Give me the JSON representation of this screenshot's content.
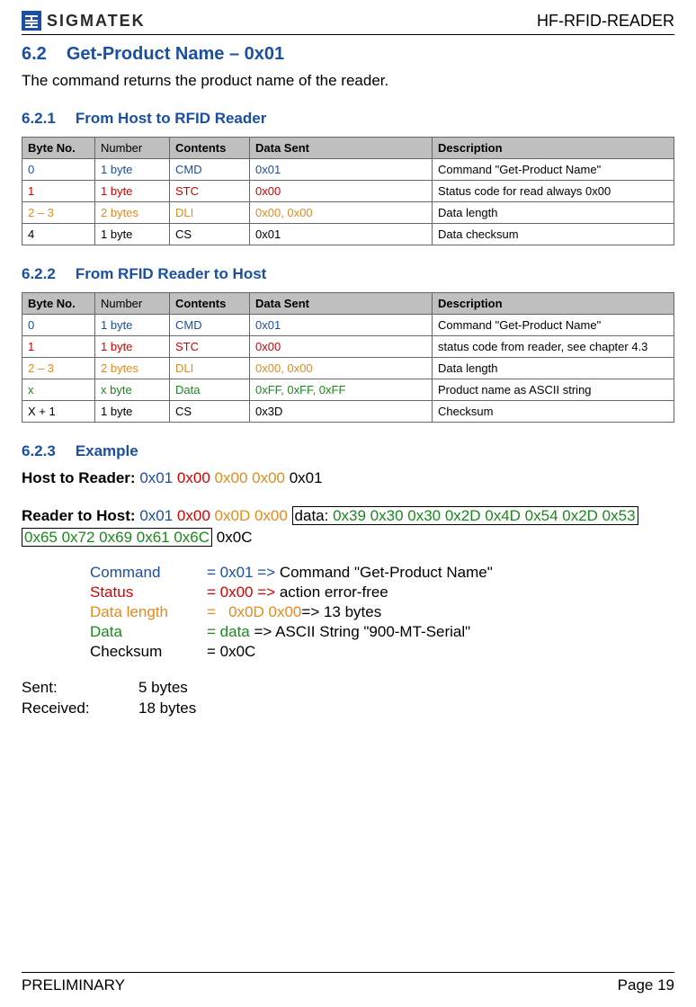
{
  "header": {
    "logo_text": "SIGMATEK",
    "product": "HF-RFID-READER"
  },
  "section": {
    "num": "6.2",
    "title": "Get-Product Name – 0x01",
    "intro": "The command returns the product name of the reader."
  },
  "sub1": {
    "num": "6.2.1",
    "title": "From Host to RFID Reader",
    "columns": [
      "Byte No.",
      "Number",
      "Contents",
      "Data Sent",
      "Description"
    ],
    "rows": [
      {
        "byte": "0",
        "num": "1 byte",
        "cont": "CMD",
        "sent": "0x01",
        "desc": "Command \"Get-Product Name\"",
        "color": "blue"
      },
      {
        "byte": "1",
        "num": "1 byte",
        "cont": "STC",
        "sent": "0x00",
        "desc": "Status code for read always 0x00",
        "color": "red"
      },
      {
        "byte": "2 – 3",
        "num": "2 bytes",
        "cont": "DLI",
        "sent": "0x00, 0x00",
        "desc": "Data length",
        "color": "orange"
      },
      {
        "byte": "4",
        "num": "1 byte",
        "cont": "CS",
        "sent": "0x01",
        "desc": "Data checksum",
        "color": "black"
      }
    ]
  },
  "sub2": {
    "num": "6.2.2",
    "title": "From RFID Reader to Host",
    "columns": [
      "Byte No.",
      "Number",
      "Contents",
      "Data Sent",
      "Description"
    ],
    "rows": [
      {
        "byte": "0",
        "num": "1 byte",
        "cont": "CMD",
        "sent": "0x01",
        "desc": "Command \"Get-Product Name\"",
        "color": "blue"
      },
      {
        "byte": "1",
        "num": "1 byte",
        "cont": "STC",
        "sent": "0x00",
        "desc": "status code from reader, see chapter 4.3",
        "color": "red"
      },
      {
        "byte": "2 – 3",
        "num": "2 bytes",
        "cont": "DLI",
        "sent": "0x00, 0x00",
        "desc": "Data length",
        "color": "orange"
      },
      {
        "byte": "x",
        "num": "x byte",
        "cont": "Data",
        "sent": "0xFF, 0xFF, 0xFF",
        "desc": "Product name as ASCII string",
        "color": "green"
      },
      {
        "byte": "X + 1",
        "num": "1 byte",
        "cont": "CS",
        "sent": "0x3D",
        "desc": "Checksum",
        "color": "black"
      }
    ]
  },
  "sub3": {
    "num": "6.2.3",
    "title": "Example",
    "host_to_reader_label": "Host to Reader:",
    "host_to_reader_bytes": {
      "cmd": "0x01",
      "stc": "0x00",
      "dli": "0x00 0x00",
      "cs": "0x01"
    },
    "reader_to_host_label": "Reader to Host:",
    "reader_to_host_bytes": {
      "cmd": "0x01",
      "stc": "0x00",
      "dli": "0x0D 0x00",
      "cs": "0x0C"
    },
    "data_label": "data:",
    "data_bytes_line1": "0x39 0x30 0x30 0x2D 0x4D 0x54 0x2D 0x53",
    "data_bytes_line2": "0x65 0x72 0x69 0x61 0x6C",
    "breakdown": {
      "command_label": "Command",
      "command_val": "= 0x01 =>",
      "command_desc": "Command \"Get-Product Name\"",
      "status_label": "Status",
      "status_val": "= 0x00 =>",
      "status_desc": "action error-free",
      "datalen_label": "Data length",
      "datalen_eq": "=",
      "datalen_val": "0x0D 0x00",
      "datalen_desc": "=> 13 bytes",
      "data_label": "Data",
      "data_eq": "= ",
      "data_val": "data",
      "data_desc": " => ASCII String \"900-MT-Serial\"",
      "checksum_label": "Checksum",
      "checksum_val": "= 0x0C"
    },
    "sentrec": {
      "sent_label": "Sent:",
      "sent_val": "5 bytes",
      "recv_label": "Received:",
      "recv_val": "18 bytes"
    }
  },
  "footer": {
    "left": "PRELIMINARY",
    "right": "Page 19"
  }
}
